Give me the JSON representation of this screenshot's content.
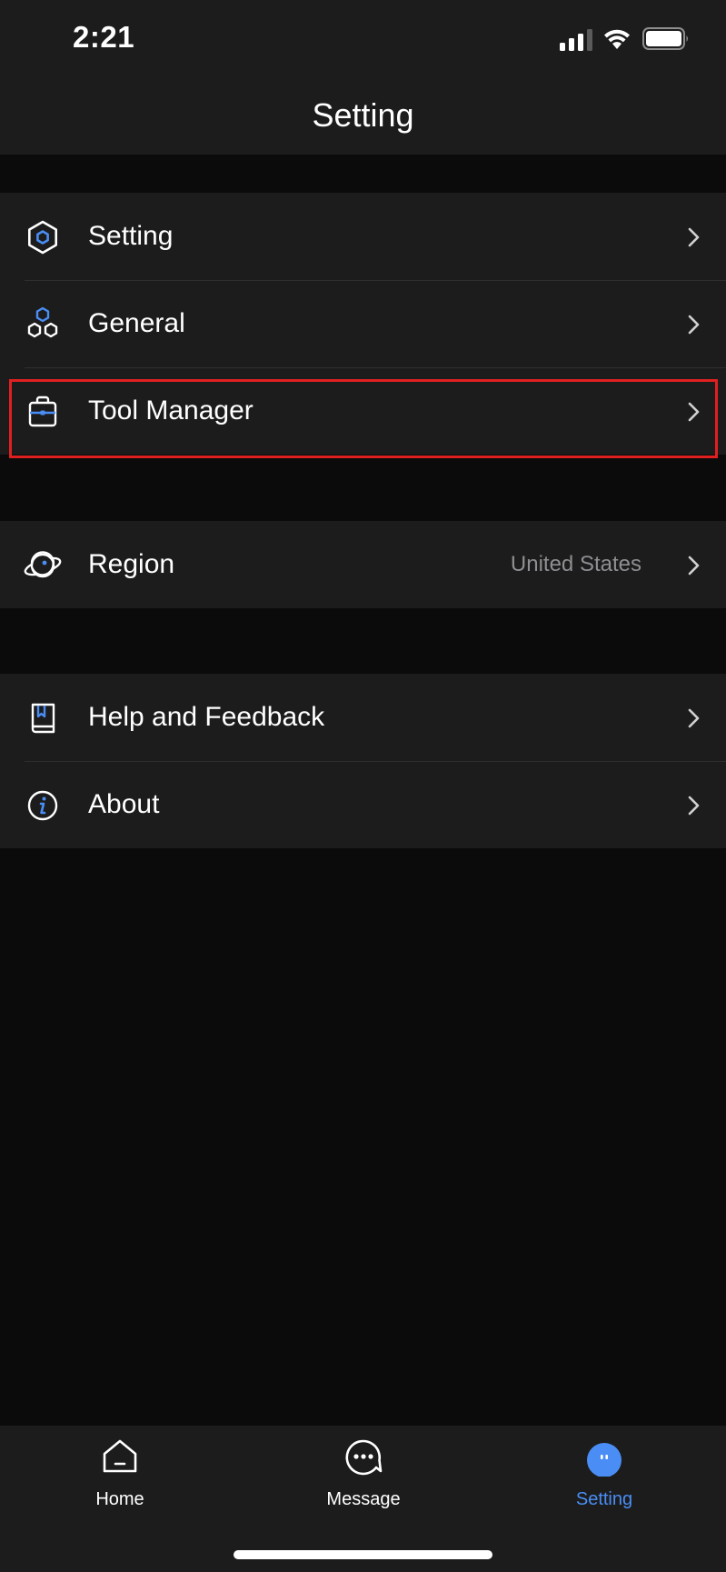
{
  "status_bar": {
    "time": "2:21"
  },
  "header": {
    "title": "Setting"
  },
  "groups": {
    "main": [
      {
        "label": "Setting",
        "icon": "hexagon-nut-icon"
      },
      {
        "label": "General",
        "icon": "three-hexagons-icon"
      },
      {
        "label": "Tool Manager",
        "icon": "toolbox-icon"
      }
    ],
    "region": {
      "label": "Region",
      "value": "United States",
      "icon": "planet-icon"
    },
    "support": [
      {
        "label": "Help and Feedback",
        "icon": "book-icon"
      },
      {
        "label": "About",
        "icon": "info-icon"
      }
    ]
  },
  "tab_bar": {
    "tabs": [
      {
        "label": "Home",
        "icon": "home-icon",
        "active": false
      },
      {
        "label": "Message",
        "icon": "message-bubble-icon",
        "active": false
      },
      {
        "label": "Setting",
        "icon": "setting-avatar-icon",
        "active": true
      }
    ]
  },
  "colors": {
    "accent": "#4a8ef5",
    "background": "#0b0b0b",
    "surface": "#1c1c1c",
    "highlight_border": "#e02020"
  }
}
